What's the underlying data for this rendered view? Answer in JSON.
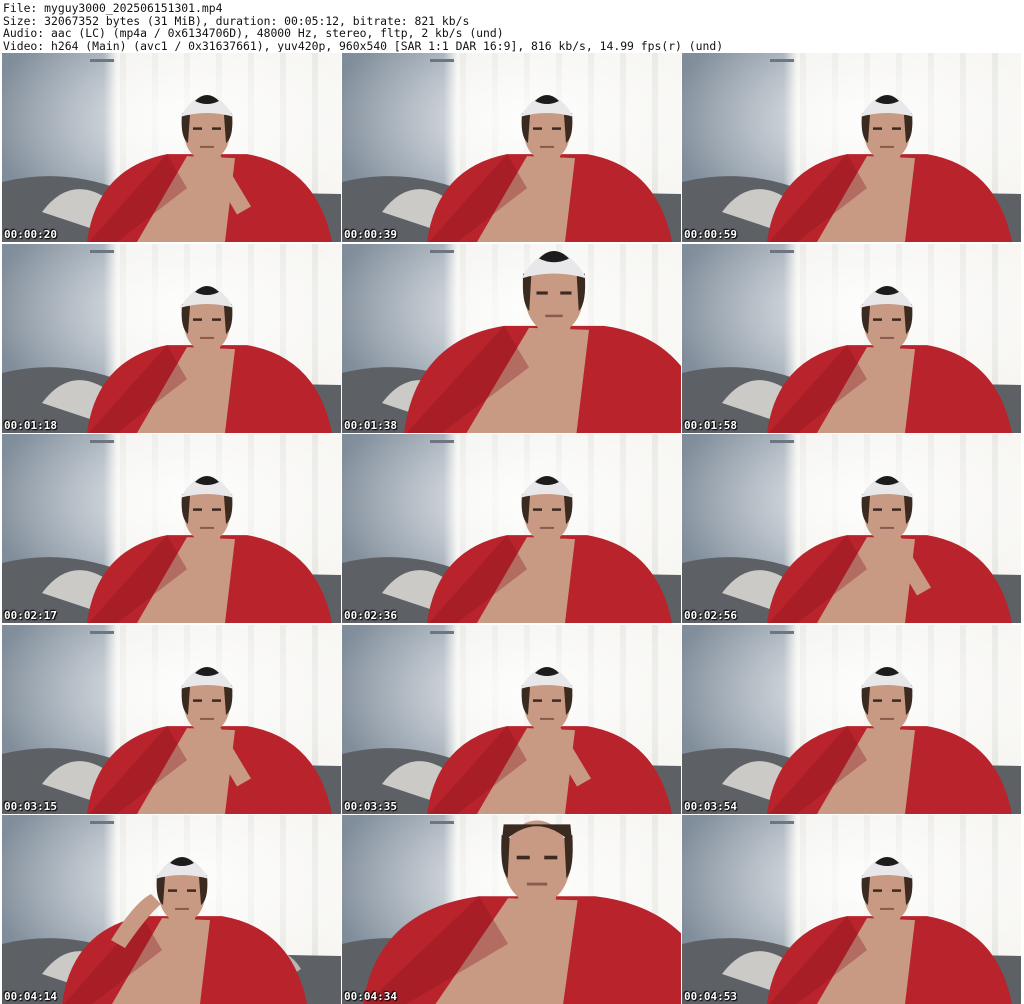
{
  "header": {
    "file_line": "File: myguy3000_202506151301.mp4",
    "size_line": "Size: 32067352 bytes (31 MiB), duration: 00:05:12, bitrate: 821 kb/s",
    "audio_line": "Audio: aac (LC) (mp4a / 0x6134706D), 48000 Hz, stereo, fltp, 2 kb/s (und)",
    "video_line": "Video: h264 (Main) (avc1 / 0x31637661), yuv420p, 960x540 [SAR 1:1 DAR 16:9], 816 kb/s, 14.99 fps(r) (und)"
  },
  "colors": {
    "shirt": "#b8232c",
    "shirt_shadow": "#8a1820",
    "skin": "#c89a84",
    "cap": "#e8e8ea",
    "hair": "#3a2a20",
    "wall": "#8e9ba8",
    "curtain": "#f1f0ec",
    "sofa": "#5d6166"
  },
  "thumbnails": [
    {
      "time": "00:00:20",
      "pose": "hand-chin"
    },
    {
      "time": "00:00:39",
      "pose": "normal"
    },
    {
      "time": "00:00:59",
      "pose": "normal"
    },
    {
      "time": "00:01:18",
      "pose": "normal"
    },
    {
      "time": "00:01:38",
      "pose": "close"
    },
    {
      "time": "00:01:58",
      "pose": "normal"
    },
    {
      "time": "00:02:17",
      "pose": "normal"
    },
    {
      "time": "00:02:36",
      "pose": "normal"
    },
    {
      "time": "00:02:56",
      "pose": "hand-chin"
    },
    {
      "time": "00:03:15",
      "pose": "hand-chin"
    },
    {
      "time": "00:03:35",
      "pose": "hand-chin"
    },
    {
      "time": "00:03:54",
      "pose": "normal"
    },
    {
      "time": "00:04:14",
      "pose": "hand-head"
    },
    {
      "time": "00:04:34",
      "pose": "closer"
    },
    {
      "time": "00:04:53",
      "pose": "normal"
    }
  ]
}
